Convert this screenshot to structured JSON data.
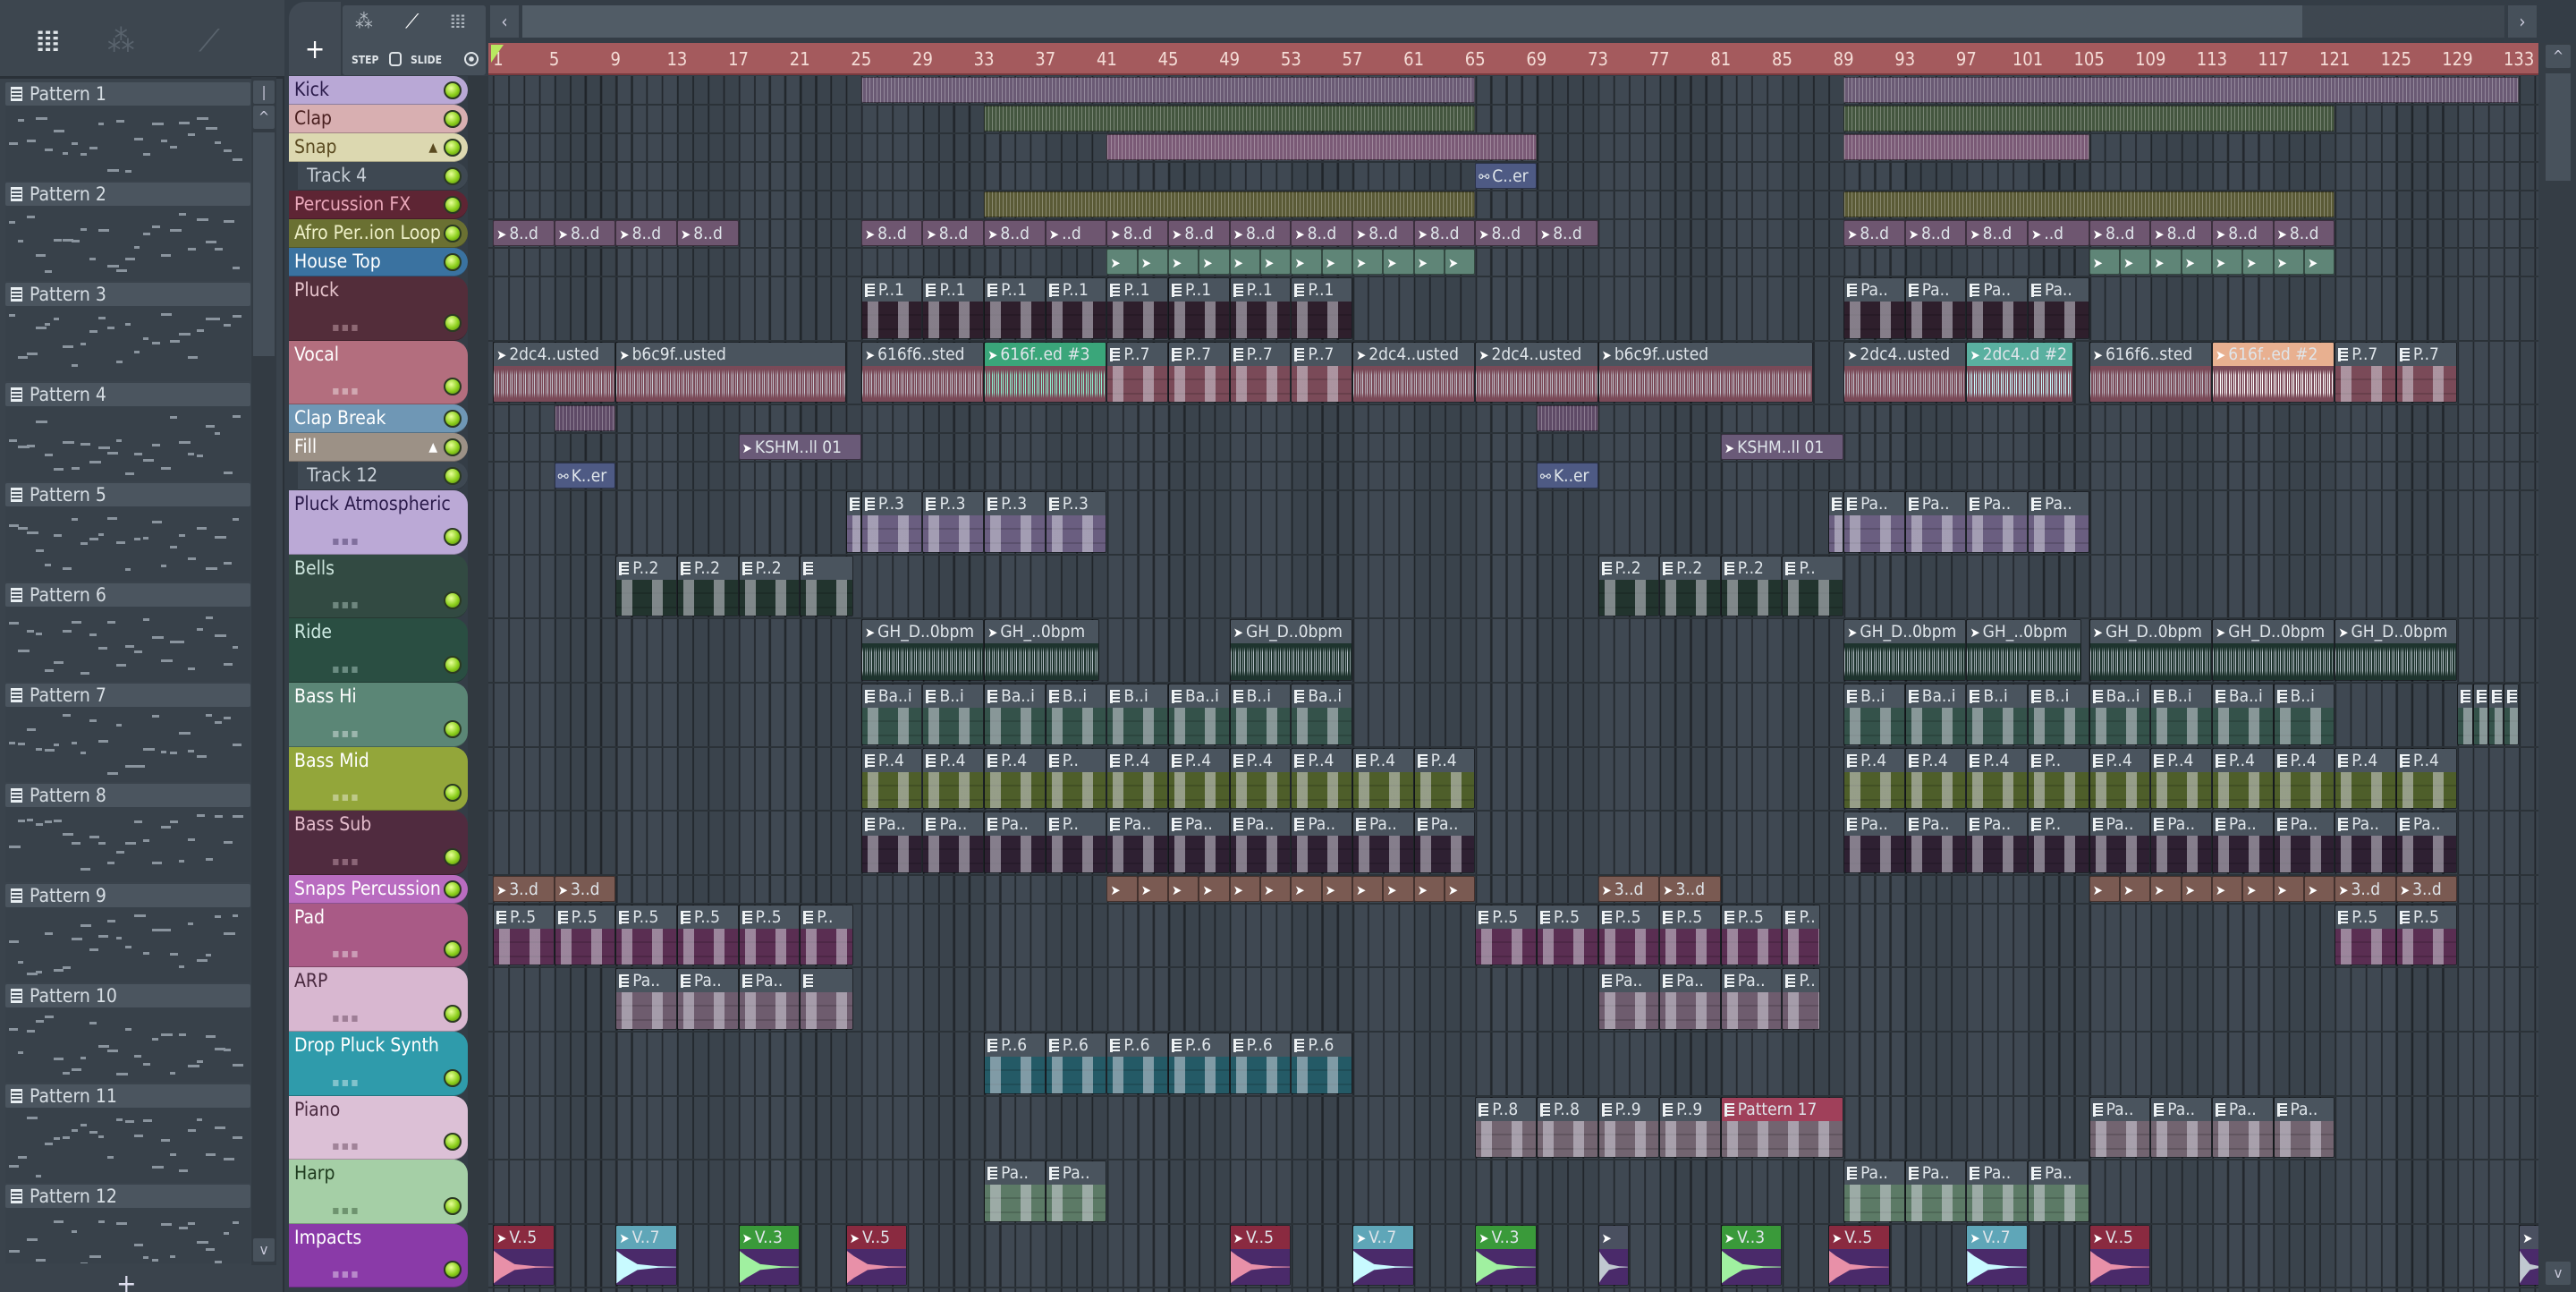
{
  "toolbar": {
    "left_icons": [
      "piano-roll-icon",
      "audio-wave-icon",
      "automation-icon"
    ],
    "add_label": "+",
    "step_label": "STEP",
    "slide_label": "SLIDE",
    "nav_left": "‹",
    "nav_right": "›"
  },
  "patterns": [
    "Pattern 1",
    "Pattern 2",
    "Pattern 3",
    "Pattern 4",
    "Pattern 5",
    "Pattern 6",
    "Pattern 7",
    "Pattern 8",
    "Pattern 9",
    "Pattern 10",
    "Pattern 11",
    "Pattern 12"
  ],
  "pattern_add": "+",
  "ruler": [
    "1",
    "5",
    "9",
    "13",
    "17",
    "21",
    "25",
    "29",
    "33",
    "37",
    "41",
    "45",
    "49",
    "53",
    "57",
    "61",
    "65",
    "69",
    "73",
    "77",
    "81",
    "85",
    "89",
    "93",
    "97",
    "101",
    "105",
    "109",
    "113",
    "117",
    "121",
    "125",
    "129",
    "133"
  ],
  "colors": {
    "ruler": "#a45a5d",
    "led": "#8ccf1c",
    "playhead": "#b8e860"
  },
  "tracks": [
    {
      "name": "Kick",
      "bg": "#b9a8d6",
      "fg": "#2a1a4a",
      "body": "#6a5a74",
      "clips": [
        {
          "s": 25,
          "l": 40,
          "k": "s"
        },
        {
          "s": 89,
          "l": 44,
          "k": "s"
        }
      ]
    },
    {
      "name": "Clap",
      "bg": "#d8afb1",
      "fg": "#4a2020",
      "body": "#44563f",
      "clips": [
        {
          "s": 33,
          "l": 32,
          "k": "s"
        },
        {
          "s": 89,
          "l": 32,
          "k": "s"
        }
      ]
    },
    {
      "name": "Snap",
      "bg": "#dcd8b0",
      "fg": "#5a4a20",
      "fold": "▲",
      "body": "#7a5a76",
      "clips": [
        {
          "s": 41,
          "l": 28,
          "k": "s"
        },
        {
          "s": 89,
          "l": 16,
          "k": "s"
        }
      ]
    },
    {
      "name": "Track 4",
      "bg": "#3e4852",
      "fg": "#c8d0d8",
      "sub": true,
      "body": "#4e5a84",
      "clips": [
        {
          "s": 65,
          "l": 4,
          "k": "m",
          "t": "C..er"
        }
      ]
    },
    {
      "name": "Percussion FX",
      "bg": "#5e2534",
      "fg": "#eaa8ba",
      "body": "#5a5a36",
      "clips": [
        {
          "s": 33,
          "l": 32,
          "k": "s"
        },
        {
          "s": 89,
          "l": 32,
          "k": "s"
        }
      ]
    },
    {
      "name": "Afro Per..ion Loop",
      "bg": "#6a7032",
      "fg": "#eef0c8",
      "body": "#6e5670",
      "clips": [
        {
          "s": 1,
          "l": 4,
          "k": "a",
          "t": "8..d",
          "n": 4
        },
        {
          "s": 25,
          "l": 4,
          "k": "a",
          "t": "8..d",
          "n": 3
        },
        {
          "s": 37,
          "l": 4,
          "k": "a",
          "t": "..d"
        },
        {
          "s": 41,
          "l": 4,
          "k": "a",
          "t": "8..d",
          "n": 7
        },
        {
          "s": 69,
          "l": 4,
          "k": "a",
          "t": "8..d"
        },
        {
          "s": 89,
          "l": 4,
          "k": "a",
          "t": "8..d",
          "n": 3
        },
        {
          "s": 101,
          "l": 4,
          "k": "a",
          "t": "..d"
        },
        {
          "s": 105,
          "l": 4,
          "k": "a",
          "t": "8..d",
          "n": 4
        }
      ]
    },
    {
      "name": "House Top",
      "bg": "#3a72a0",
      "fg": "#ffffff",
      "body": "#5f8577",
      "clips": [
        {
          "s": 41,
          "l": 2,
          "k": "x",
          "n": 12
        },
        {
          "s": 105,
          "l": 2,
          "k": "x",
          "n": 8
        }
      ]
    },
    {
      "name": "Pluck",
      "bg": "#532d3a",
      "fg": "#e6c4cc",
      "body": "#2e1f2c",
      "clips": [
        {
          "s": 25,
          "l": 4,
          "k": "p",
          "t": "P..1",
          "n": 8
        },
        {
          "s": 89,
          "l": 4,
          "k": "p",
          "t": "Pa..",
          "n": 4
        }
      ]
    },
    {
      "name": "Vocal",
      "bg": "#b36e7e",
      "fg": "#ffffff",
      "body": "#7a4a58",
      "clips": [
        {
          "s": 1,
          "l": 8,
          "k": "a",
          "t": "2dc4..usted"
        },
        {
          "s": 9,
          "l": 15,
          "k": "a",
          "t": "b6c9f..usted"
        },
        {
          "s": 25,
          "l": 8,
          "k": "a",
          "t": "616f6..sted"
        },
        {
          "s": 33,
          "l": 8,
          "k": "a",
          "t": "616f..ed #3",
          "hc": "#3aa67a",
          "wc": "#8ff0d0"
        },
        {
          "s": 41,
          "l": 4,
          "k": "p",
          "t": "P..7",
          "n": 4
        },
        {
          "s": 57,
          "l": 8,
          "k": "a",
          "t": "2dc4..usted"
        },
        {
          "s": 65,
          "l": 8,
          "k": "a",
          "t": "2dc4..usted"
        },
        {
          "s": 73,
          "l": 14,
          "k": "a",
          "t": "b6c9f..usted"
        },
        {
          "s": 89,
          "l": 8,
          "k": "a",
          "t": "2dc4..usted"
        },
        {
          "s": 97,
          "l": 7,
          "k": "a",
          "t": "2dc4..d #2",
          "hc": "#5ab0a0",
          "wc": "#c8faff"
        },
        {
          "s": 105,
          "l": 8,
          "k": "a",
          "t": "616f6..sted"
        },
        {
          "s": 113,
          "l": 8,
          "k": "a",
          "t": "616f..ed #2",
          "hc": "#e8b090",
          "wc": "#ffffff"
        },
        {
          "s": 121,
          "l": 4,
          "k": "p",
          "t": "P..7",
          "n": 2
        }
      ]
    },
    {
      "name": "Clap Break",
      "bg": "#6f97b5",
      "fg": "#ffffff",
      "body": "#5e4a66",
      "clips": [
        {
          "s": 5,
          "l": 4,
          "k": "s"
        },
        {
          "s": 69,
          "l": 4,
          "k": "s"
        }
      ]
    },
    {
      "name": "Fill",
      "bg": "#9c9186",
      "fg": "#ffffff",
      "fold": "▲",
      "body": "#6a5a78",
      "clips": [
        {
          "s": 17,
          "l": 8,
          "k": "a",
          "t": "KSHM..ll 01"
        },
        {
          "s": 81,
          "l": 8,
          "k": "a",
          "t": "KSHM..ll 01"
        }
      ]
    },
    {
      "name": "Track 12",
      "bg": "#3e4852",
      "fg": "#c8d0d8",
      "sub": true,
      "body": "#4e5a84",
      "clips": [
        {
          "s": 5,
          "l": 4,
          "k": "m",
          "t": "K..er"
        },
        {
          "s": 69,
          "l": 4,
          "k": "m",
          "t": "K..er"
        }
      ]
    },
    {
      "name": "Pluck Atmospheric",
      "bg": "#bba9d6",
      "fg": "#2a1a4a",
      "body": "#6a5e80",
      "clips": [
        {
          "s": 24,
          "l": 1,
          "k": "p",
          "t": ""
        },
        {
          "s": 25,
          "l": 4,
          "k": "p",
          "t": "P..3",
          "n": 4
        },
        {
          "s": 88,
          "l": 1,
          "k": "p",
          "t": ""
        },
        {
          "s": 89,
          "l": 4,
          "k": "p",
          "t": "Pa..",
          "n": 4
        }
      ]
    },
    {
      "name": "Bells",
      "bg": "#324a42",
      "fg": "#cce4dc",
      "body": "#22342e",
      "clips": [
        {
          "s": 9,
          "l": 4,
          "k": "p",
          "t": "P..2",
          "n": 3
        },
        {
          "s": 21,
          "l": 3.5,
          "k": "p",
          "t": ""
        },
        {
          "s": 73,
          "l": 4,
          "k": "p",
          "t": "P..2",
          "n": 3
        },
        {
          "s": 85,
          "l": 4,
          "k": "p",
          "t": "P.."
        }
      ]
    },
    {
      "name": "Ride",
      "bg": "#2a4e42",
      "fg": "#cceae2",
      "body": "#1e342e",
      "clips": [
        {
          "s": 25,
          "l": 8,
          "k": "a",
          "t": "GH_D..0bpm"
        },
        {
          "s": 33,
          "l": 7.5,
          "k": "a",
          "t": "GH_..0bpm"
        },
        {
          "s": 49,
          "l": 8,
          "k": "a",
          "t": "GH_D..0bpm"
        },
        {
          "s": 89,
          "l": 8,
          "k": "a",
          "t": "GH_D..0bpm"
        },
        {
          "s": 97,
          "l": 7.5,
          "k": "a",
          "t": "GH_..0bpm"
        },
        {
          "s": 105,
          "l": 8,
          "k": "a",
          "t": "GH_D..0bpm"
        },
        {
          "s": 113,
          "l": 8,
          "k": "a",
          "t": "GH_D..0bpm"
        },
        {
          "s": 121,
          "l": 8,
          "k": "a",
          "t": "GH_D..0bpm"
        }
      ]
    },
    {
      "name": "Bass Hi",
      "bg": "#5b8676",
      "fg": "#ffffff",
      "body": "#34524a",
      "clips": [
        {
          "s": 25,
          "l": 4,
          "k": "p",
          "ts": [
            "Ba..i",
            "B..i",
            "Ba..i",
            "B..i",
            "B..i",
            "Ba..i",
            "B..i",
            "Ba..i"
          ]
        },
        {
          "s": 89,
          "l": 4,
          "k": "p",
          "ts": [
            "B..i",
            "Ba..i",
            "B..i",
            "B..i",
            "Ba..i",
            "B..i",
            "Ba..i",
            "B..i"
          ]
        },
        {
          "s": 129,
          "l": 1,
          "k": "p",
          "t": "",
          "n": 4
        }
      ]
    },
    {
      "name": "Bass Mid",
      "bg": "#93a63a",
      "fg": "#ffffff",
      "body": "#4e5e2a",
      "clips": [
        {
          "s": 25,
          "l": 4,
          "k": "p",
          "ts": [
            "P..4",
            "P..4",
            "P..4",
            "P.."
          ]
        },
        {
          "s": 41,
          "l": 4,
          "k": "p",
          "t": "P..4",
          "n": 6
        },
        {
          "s": 89,
          "l": 4,
          "k": "p",
          "ts": [
            "P..4",
            "P..4",
            "P..4",
            "P.."
          ]
        },
        {
          "s": 105,
          "l": 4,
          "k": "p",
          "t": "P..4",
          "n": 6
        }
      ]
    },
    {
      "name": "Bass Sub",
      "bg": "#502b3f",
      "fg": "#e4bccc",
      "body": "#2e2032",
      "clips": [
        {
          "s": 25,
          "l": 4,
          "k": "p",
          "ts": [
            "Pa..",
            "Pa..",
            "Pa..",
            "P.."
          ]
        },
        {
          "s": 41,
          "l": 4,
          "k": "p",
          "t": "Pa..",
          "n": 6
        },
        {
          "s": 89,
          "l": 4,
          "k": "p",
          "ts": [
            "Pa..",
            "Pa..",
            "Pa..",
            "P.."
          ]
        },
        {
          "s": 105,
          "l": 4,
          "k": "p",
          "t": "Pa..",
          "n": 6
        }
      ]
    },
    {
      "name": "Snaps Percussion",
      "bg": "#b96cc0",
      "fg": "#ffffff",
      "body": "#7a5a52",
      "clips": [
        {
          "s": 1,
          "l": 4,
          "k": "a",
          "t": "3..d",
          "n": 2
        },
        {
          "s": 41,
          "l": 2,
          "k": "x",
          "n": 12
        },
        {
          "s": 73,
          "l": 4,
          "k": "a",
          "t": "3..d",
          "n": 2
        },
        {
          "s": 105,
          "l": 2,
          "k": "x",
          "n": 8
        },
        {
          "s": 121,
          "l": 4,
          "k": "a",
          "t": "3..d",
          "n": 2
        }
      ]
    },
    {
      "name": "Pad",
      "bg": "#a95a86",
      "fg": "#ffffff",
      "body": "#5a2e52",
      "clips": [
        {
          "s": 1,
          "l": 4,
          "k": "p",
          "t": "P..5",
          "n": 5
        },
        {
          "s": 21,
          "l": 3.5,
          "k": "p",
          "t": "P.."
        },
        {
          "s": 65,
          "l": 4,
          "k": "p",
          "t": "P..5",
          "n": 5
        },
        {
          "s": 85,
          "l": 2.5,
          "k": "p",
          "t": "P.."
        },
        {
          "s": 121,
          "l": 4,
          "k": "p",
          "t": "P..5",
          "n": 2
        }
      ]
    },
    {
      "name": "ARP",
      "bg": "#d8b7d0",
      "fg": "#4a2a40",
      "body": "#6e5c6e",
      "clips": [
        {
          "s": 9,
          "l": 4,
          "k": "p",
          "t": "Pa..",
          "n": 3
        },
        {
          "s": 21,
          "l": 3.5,
          "k": "p",
          "t": ""
        },
        {
          "s": 73,
          "l": 4,
          "k": "p",
          "t": "Pa..",
          "n": 3
        },
        {
          "s": 85,
          "l": 2.5,
          "k": "p",
          "t": "P.."
        }
      ]
    },
    {
      "name": "Drop Pluck Synth",
      "bg": "#2f9bab",
      "fg": "#ffffff",
      "body": "#245a66",
      "clips": [
        {
          "s": 33,
          "l": 4,
          "k": "p",
          "t": "P..6",
          "n": 6
        }
      ]
    },
    {
      "name": "Piano",
      "bg": "#dcc0d6",
      "fg": "#4a2a40",
      "body": "#726470",
      "clips": [
        {
          "s": 65,
          "l": 4,
          "k": "p",
          "t": "P..8",
          "n": 2
        },
        {
          "s": 73,
          "l": 4,
          "k": "p",
          "t": "P..9",
          "n": 2
        },
        {
          "s": 81,
          "l": 8,
          "k": "p",
          "t": "Pattern 17",
          "hc": "#a0405a"
        },
        {
          "s": 105,
          "l": 4,
          "k": "p",
          "t": "Pa..",
          "n": 4
        }
      ]
    },
    {
      "name": "Harp",
      "bg": "#a5cfa6",
      "fg": "#1e3a1e",
      "body": "#5c7a66",
      "clips": [
        {
          "s": 33,
          "l": 4,
          "k": "p",
          "t": "Pa..",
          "n": 2
        },
        {
          "s": 89,
          "l": 4,
          "k": "p",
          "t": "Pa..",
          "n": 4
        }
      ]
    },
    {
      "name": "Impacts",
      "bg": "#8a3aa8",
      "fg": "#ffffff",
      "body": "#4a2a6a",
      "clips": [
        {
          "s": 1,
          "l": 4,
          "k": "i",
          "t": "V..5",
          "hc": "#8a2a40",
          "wc": "#e890a8"
        },
        {
          "s": 9,
          "l": 4,
          "k": "i",
          "t": "V..7",
          "hc": "#5fa6b8",
          "wc": "#c8faff"
        },
        {
          "s": 17,
          "l": 4,
          "k": "i",
          "t": "V..3",
          "hc": "#3a9a3a",
          "wc": "#a0f0a0"
        },
        {
          "s": 24,
          "l": 4,
          "k": "i",
          "t": "V..5",
          "hc": "#8a2a40",
          "wc": "#e890a8"
        },
        {
          "s": 49,
          "l": 4,
          "k": "i",
          "t": "V..5",
          "hc": "#8a2a40",
          "wc": "#e890a8"
        },
        {
          "s": 57,
          "l": 4,
          "k": "i",
          "t": "V..7",
          "hc": "#5fa6b8",
          "wc": "#c8faff"
        },
        {
          "s": 65,
          "l": 4,
          "k": "i",
          "t": "V..3",
          "hc": "#3a9a3a",
          "wc": "#a0f0a0"
        },
        {
          "s": 73,
          "l": 2,
          "k": "i",
          "t": "",
          "hc": "#4a5060",
          "wc": "#c0c8d0"
        },
        {
          "s": 81,
          "l": 4,
          "k": "i",
          "t": "V..3",
          "hc": "#3a9a3a",
          "wc": "#a0f0a0"
        },
        {
          "s": 88,
          "l": 4,
          "k": "i",
          "t": "V..5",
          "hc": "#8a2a40",
          "wc": "#e890a8"
        },
        {
          "s": 97,
          "l": 4,
          "k": "i",
          "t": "V..7",
          "hc": "#5fa6b8",
          "wc": "#c8faff"
        },
        {
          "s": 105,
          "l": 4,
          "k": "i",
          "t": "V..5",
          "hc": "#8a2a40",
          "wc": "#e890a8"
        },
        {
          "s": 133,
          "l": 2,
          "k": "i",
          "t": "",
          "hc": "#4a5060",
          "wc": "#c0c8d0"
        }
      ]
    }
  ]
}
